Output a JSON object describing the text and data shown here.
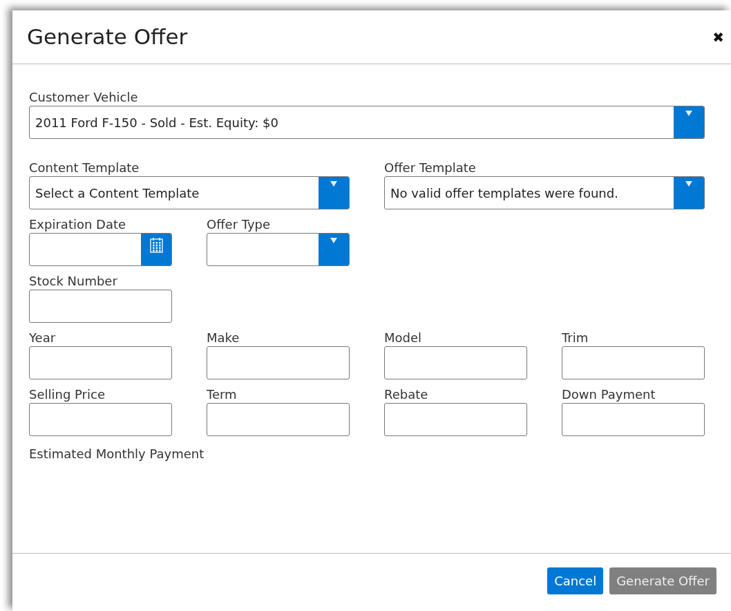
{
  "dialog": {
    "title": "Generate Offer",
    "close": "✖"
  },
  "rows": [
    [
      {
        "label": "Customer Vehicle",
        "kind": "select",
        "value": "2011 Ford F-150 - Sold - Est. Equity: $0"
      }
    ],
    [
      {
        "label": "Content Template",
        "kind": "select",
        "value": "Select a Content Template"
      },
      {
        "label": "Offer Template",
        "kind": "select",
        "value": "No valid offer templates were found."
      }
    ],
    [
      {
        "label": "Expiration Date",
        "kind": "date"
      },
      {
        "label": "Offer Type",
        "kind": "select"
      }
    ],
    [
      {
        "label": "Stock Number",
        "kind": "text"
      }
    ],
    [
      {
        "label": "Year",
        "kind": "text"
      },
      {
        "label": "Make",
        "kind": "text"
      },
      {
        "label": "Model",
        "kind": "text"
      },
      {
        "label": "Trim",
        "kind": "text"
      }
    ],
    [
      {
        "label": "Selling Price",
        "kind": "text"
      },
      {
        "label": "Term",
        "kind": "text"
      },
      {
        "label": "Rebate",
        "kind": "text"
      },
      {
        "label": "Down Payment",
        "kind": "text"
      }
    ]
  ],
  "estimate_label": "Estimated Monthly Payment",
  "buttons": [
    {
      "label": "Cancel",
      "disabled": false
    },
    {
      "label": "Generate Offer",
      "disabled": true
    }
  ]
}
